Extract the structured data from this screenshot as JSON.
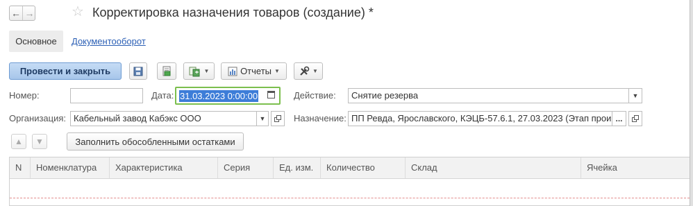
{
  "window": {
    "title": "Корректировка назначения товаров (создание) *"
  },
  "nav": {
    "back_glyph": "←",
    "forward_glyph": "→",
    "favorite_glyph": "☆"
  },
  "tabs": [
    {
      "label": "Основное",
      "active": true
    },
    {
      "label": "Документооборот",
      "active": false
    }
  ],
  "toolbar": {
    "post_and_close_label": "Провести и закрыть",
    "reports_label": "Отчеты"
  },
  "form": {
    "number_label": "Номер:",
    "number_value": "",
    "date_label": "Дата:",
    "date_value": "31.03.2023  0:00:00",
    "action_label": "Действие:",
    "action_value": "Снятие резерва",
    "organization_label": "Организация:",
    "organization_value": "Кабельный завод Кабэкс ООО",
    "assignment_label": "Назначение:",
    "assignment_value": "ПП Ревда, Ярославского, КЭЦБ-57.6.1, 27.03.2023 (Этап прои",
    "ellipsis_label": "..."
  },
  "table_toolbar": {
    "fill_button_label": "Заполнить обособленными остатками"
  },
  "table": {
    "columns": [
      "N",
      "Номенклатура",
      "Характеристика",
      "Серия",
      "Ед. изм.",
      "Количество",
      "Склад",
      "Ячейка"
    ]
  },
  "colors": {
    "accent": "#a7c6ea",
    "link": "#2b5fb5",
    "focus": "#7bbf4d",
    "selection": "#3d7dd8"
  }
}
